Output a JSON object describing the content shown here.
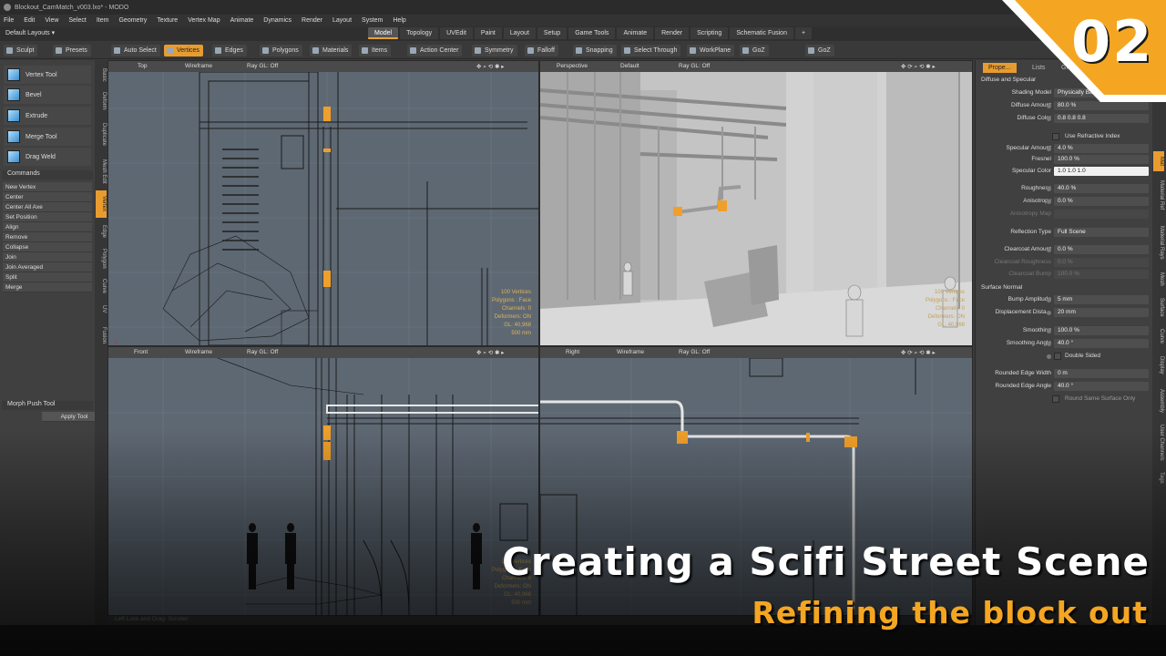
{
  "window": {
    "title": "Blockout_CamMatch_v003.lxo* - MODO"
  },
  "menu": [
    "File",
    "Edit",
    "View",
    "Select",
    "Item",
    "Geometry",
    "Texture",
    "Vertex Map",
    "Animate",
    "Dynamics",
    "Render",
    "Layout",
    "System",
    "Help"
  ],
  "layout": {
    "selector": "Default Layouts ▾"
  },
  "mode_tabs": [
    {
      "label": "Model",
      "active": true
    },
    {
      "label": "Topology"
    },
    {
      "label": "UVEdit"
    },
    {
      "label": "Paint"
    },
    {
      "label": "Layout"
    },
    {
      "label": "Setup"
    },
    {
      "label": "Game Tools"
    },
    {
      "label": "Animate"
    },
    {
      "label": "Render"
    },
    {
      "label": "Scripting"
    },
    {
      "label": "Schematic Fusion"
    },
    {
      "label": "+"
    }
  ],
  "toolbar": {
    "sculpt": "Sculpt",
    "presets": "Presets",
    "auto_select": "Auto Select",
    "vertices": "Vertices",
    "edges": "Edges",
    "polygons": "Polygons",
    "materials": "Materials",
    "items": "Items",
    "action_center": "Action Center",
    "symmetry": "Symmetry",
    "falloff": "Falloff",
    "snapping": "Snapping",
    "select_through": "Select Through",
    "workplane": "WorkPlane",
    "goz1": "GoZ",
    "goz2": "GoZ"
  },
  "left_panel": {
    "tools": [
      "Vertex Tool",
      "Bevel",
      "Extrude",
      "Merge Tool",
      "Drag Weld"
    ],
    "commands_header": "Commands",
    "commands": [
      "New Vertex",
      "Center",
      "Center All Axe",
      "Set Position",
      "Align",
      "Remove",
      "Collapse",
      "Join",
      "Join Averaged",
      "Split",
      "Merge"
    ],
    "vtabs": [
      "Basic",
      "Deform",
      "Duplicate",
      "Mesh Edit",
      "Vertex",
      "Edge",
      "Polygon",
      "Curve",
      "UV",
      "Fusion"
    ],
    "active_vtab": "Vertex",
    "morph_header": "Morph Push Tool",
    "apply_tool": "Apply Tool"
  },
  "viewports": {
    "top": {
      "view": "Top",
      "shading": "Wireframe",
      "raygl": "Ray GL: Off",
      "info": [
        "100 Vertices",
        "Polygons : Face",
        "Channels: 0",
        "Deformers: ON",
        "GL: 40,968",
        "500 mm"
      ]
    },
    "perspective": {
      "view": "Perspective",
      "shading": "Default",
      "raygl": "Ray GL: Off",
      "info": [
        "100 Vertices",
        "Polygons : Face",
        "Channels: 0",
        "Deformers: ON",
        "GL: 40,968"
      ]
    },
    "front": {
      "view": "Front",
      "shading": "Wireframe",
      "raygl": "Ray GL: Off",
      "info": [
        "100 Vertices",
        "Polygons : Face",
        "Channels: 0",
        "Deformers: ON",
        "GL: 40,968",
        "500 mm"
      ]
    },
    "right": {
      "view": "Right",
      "shading": "Wireframe",
      "raygl": "Ray GL: Off"
    }
  },
  "properties": {
    "tabs": [
      "Prope...",
      "Lists",
      "Gro..."
    ],
    "diffuse_section": "Diffuse and Specular",
    "rows": [
      {
        "label": "Shading Model",
        "value": "Physically Based"
      },
      {
        "label": "Diffuse Amount",
        "value": "80.0 %"
      },
      {
        "label": "Diffuse Color",
        "value": "0.8      0.8      0.8"
      },
      {
        "label": "Use Refractive Index",
        "value": ""
      },
      {
        "label": "Specular Amount",
        "value": "4.0 %"
      },
      {
        "label": "Fresnel",
        "value": "100.0 %"
      },
      {
        "label": "Specular Color",
        "value": "1.0      1.0      1.0"
      },
      {
        "label": "Roughness",
        "value": "40.0 %"
      },
      {
        "label": "Anisotropy",
        "value": "0.0 %"
      },
      {
        "label": "Anisotropy Map",
        "value": ""
      },
      {
        "label": "Reflection Type",
        "value": "Full Scene"
      },
      {
        "label": "Clearcoat Amount",
        "value": "0.0 %"
      },
      {
        "label": "Clearcoat Roughness",
        "value": "0.0 %"
      },
      {
        "label": "Clearcoat Bump",
        "value": "100.0 %"
      }
    ],
    "surface_section": "Surface Normal",
    "rows2": [
      {
        "label": "Bump Amplitude",
        "value": "5 mm"
      },
      {
        "label": "Displacement Dista...",
        "value": "20 mm"
      },
      {
        "label": "Smoothing",
        "value": "100.0 %"
      },
      {
        "label": "Smoothing Angle",
        "value": "40.0 °"
      },
      {
        "label": "Double Sided",
        "value": ""
      },
      {
        "label": "Rounded Edge Width",
        "value": "0 m"
      },
      {
        "label": "Rounded Edge Angle",
        "value": "40.0 °"
      },
      {
        "label": "Round Same Surface Only",
        "value": ""
      }
    ],
    "vtabs": [
      "Mat",
      "Material Ref",
      "Material Rays",
      "Mesh",
      "Surface",
      "Curve",
      "Display",
      "Assembly",
      "User Channels",
      "Tags"
    ]
  },
  "status": "Left Lock and Drag:   Scroller",
  "overlay": {
    "episode": "02",
    "title": "Creating a Scifi Street Scene",
    "subtitle": "Refining the block out",
    "accent": "#F4A622"
  }
}
